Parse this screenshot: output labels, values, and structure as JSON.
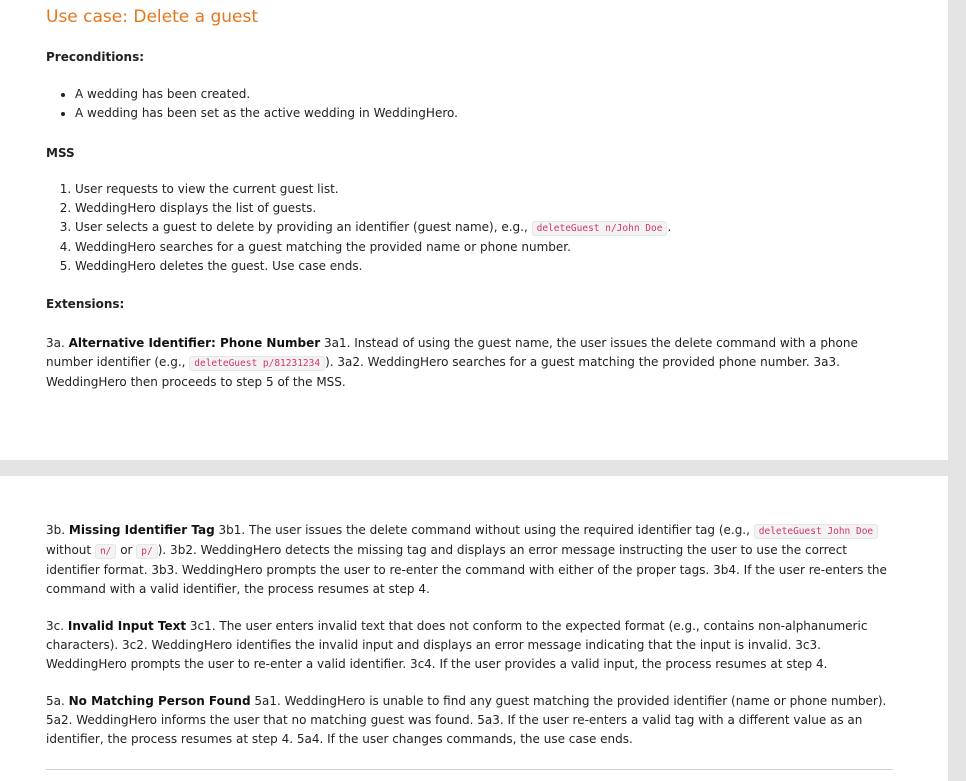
{
  "title": "Use case: Delete a guest",
  "preconditions": {
    "heading": "Preconditions:",
    "items": [
      "A wedding has been created.",
      "A wedding has been set as the active wedding in WeddingHero."
    ]
  },
  "mss": {
    "heading": "MSS",
    "step1": "User requests to view the current guest list.",
    "step2": "WeddingHero displays the list of guests.",
    "step3_text": "User selects a guest to delete by providing an identifier (guest name), e.g., ",
    "step3_code": "deleteGuest n/John Doe",
    "step3_end": ".",
    "step4": "WeddingHero searches for a guest matching the provided name or phone number.",
    "step5": "WeddingHero deletes the guest. Use case ends."
  },
  "extensions": {
    "heading": "Extensions:",
    "e3a": {
      "id": "3a.",
      "title": "Alternative Identifier: Phone Number",
      "t1": " 3a1. Instead of using the guest name, the user issues the delete command with a phone number identifier (e.g., ",
      "code1": "deleteGuest p/81231234",
      "t2": "). 3a2. WeddingHero searches for a guest matching the provided phone number. 3a3. WeddingHero then proceeds to step 5 of the MSS."
    },
    "e3b": {
      "id": "3b.",
      "title": "Missing Identifier Tag",
      "t1": " 3b1. The user issues the delete command without using the required identifier tag (e.g., ",
      "code1": "deleteGuest John Doe",
      "t2": " without ",
      "code2": "n/",
      "t3": " or ",
      "code3": "p/",
      "t4": "). 3b2. WeddingHero detects the missing tag and displays an error message instructing the user to use the correct identifier format. 3b3. WeddingHero prompts the user to re-enter the command with either of the proper tags. 3b4. If the user re-enters the command with a valid identifier, the process resumes at step 4."
    },
    "e3c": {
      "id": "3c.",
      "title": "Invalid Input Text",
      "t1": " 3c1. The user enters invalid text that does not conform to the expected format (e.g., contains non-alphanumeric characters). 3c2. WeddingHero identifies the invalid input and displays an error message indicating that the input is invalid. 3c3. WeddingHero prompts the user to re-enter a valid identifier. 3c4. If the user provides a valid input, the process resumes at step 4."
    },
    "e5a": {
      "id": "5a.",
      "title": "No Matching Person Found",
      "t1": " 5a1. WeddingHero is unable to find any guest matching the provided identifier (name or phone number). 5a2. WeddingHero informs the user that no matching guest was found. 5a3. If the user re-enters a valid tag with a different value as an identifier, the process resumes at step 4. 5a4. If the user changes commands, the use case ends."
    }
  }
}
